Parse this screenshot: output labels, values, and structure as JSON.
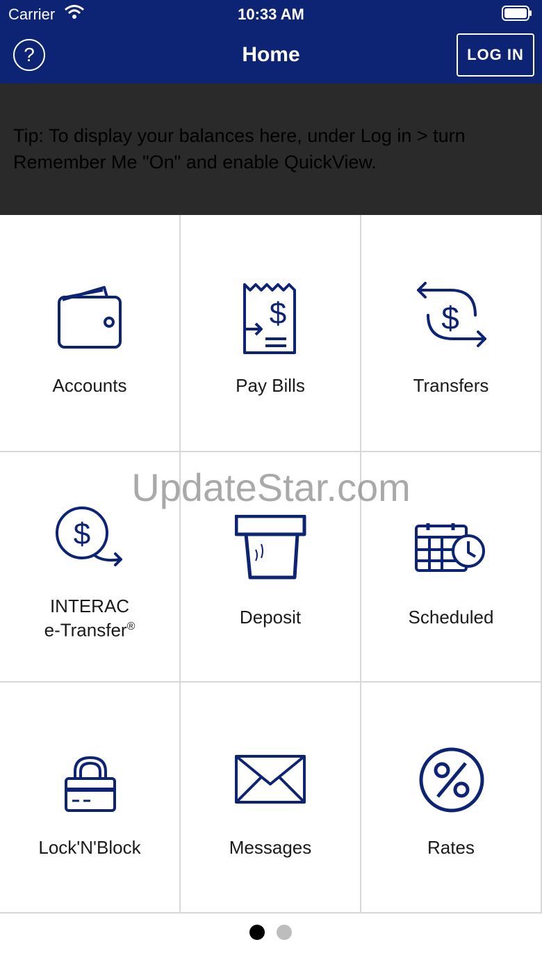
{
  "status_bar": {
    "carrier": "Carrier",
    "time": "10:33 AM"
  },
  "header": {
    "title": "Home",
    "help_icon": "?",
    "login_label": "LOG IN"
  },
  "tip": {
    "text": "Tip: To display your balances here, under Log in > turn Remember Me \"On\" and enable QuickView."
  },
  "tiles": [
    {
      "label": "Accounts",
      "icon": "wallet-icon"
    },
    {
      "label": "Pay Bills",
      "icon": "bill-icon"
    },
    {
      "label": "Transfers",
      "icon": "transfer-icon"
    },
    {
      "label_line1": "INTERAC",
      "label_line2": "e-Transfer",
      "label_sup": "®",
      "icon": "etransfer-icon"
    },
    {
      "label": "Deposit",
      "icon": "deposit-icon"
    },
    {
      "label": "Scheduled",
      "icon": "calendar-clock-icon"
    },
    {
      "label": "Lock'N'Block",
      "icon": "lock-card-icon"
    },
    {
      "label": "Messages",
      "icon": "envelope-icon"
    },
    {
      "label": "Rates",
      "icon": "percent-icon"
    }
  ],
  "watermark": "UpdateStar.com",
  "pager": {
    "active": 1,
    "total": 2
  },
  "colors": {
    "brand_navy": "#0d2474",
    "tip_bg": "#2a2a2a",
    "icon": "#0d2474"
  }
}
